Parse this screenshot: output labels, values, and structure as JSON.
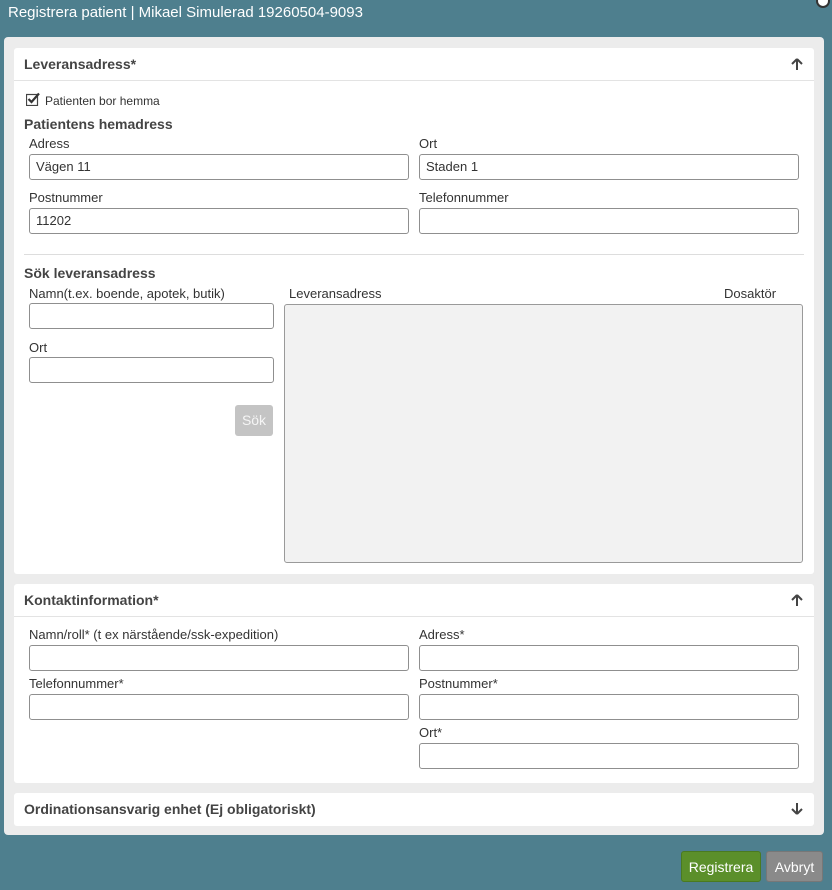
{
  "window": {
    "title": "Registrera patient | Mikael Simulerad 19260504-9093"
  },
  "delivery": {
    "title": "Leveransadress*",
    "lives_home_label": "Patienten bor hemma",
    "lives_home_checked": true,
    "home_title": "Patientens hemadress",
    "address_label": "Adress",
    "address_value": "Vägen 11",
    "city_label": "Ort",
    "city_value": "Staden 1",
    "postal_label": "Postnummer",
    "postal_value": "11202",
    "phone_label": "Telefonnummer",
    "phone_value": "",
    "search_title": "Sök leveransadress",
    "name_label": "Namn(t.ex. boende, apotek, butik)",
    "name_value": "",
    "search_city_label": "Ort",
    "search_city_value": "",
    "search_button": "Sök",
    "col_address": "Leveransadress",
    "col_actor": "Dosaktör"
  },
  "contact": {
    "title": "Kontaktinformation*",
    "name_label": "Namn/roll* (t ex närstående/ssk-expedition)",
    "address_label": "Adress*",
    "phone_label": "Telefonnummer*",
    "postal_label": "Postnummer*",
    "city_label": "Ort*"
  },
  "unit": {
    "title": "Ordinationsansvarig enhet (Ej obligatoriskt)"
  },
  "footer": {
    "register_button": "Registrera",
    "cancel_button": "Avbryt"
  }
}
